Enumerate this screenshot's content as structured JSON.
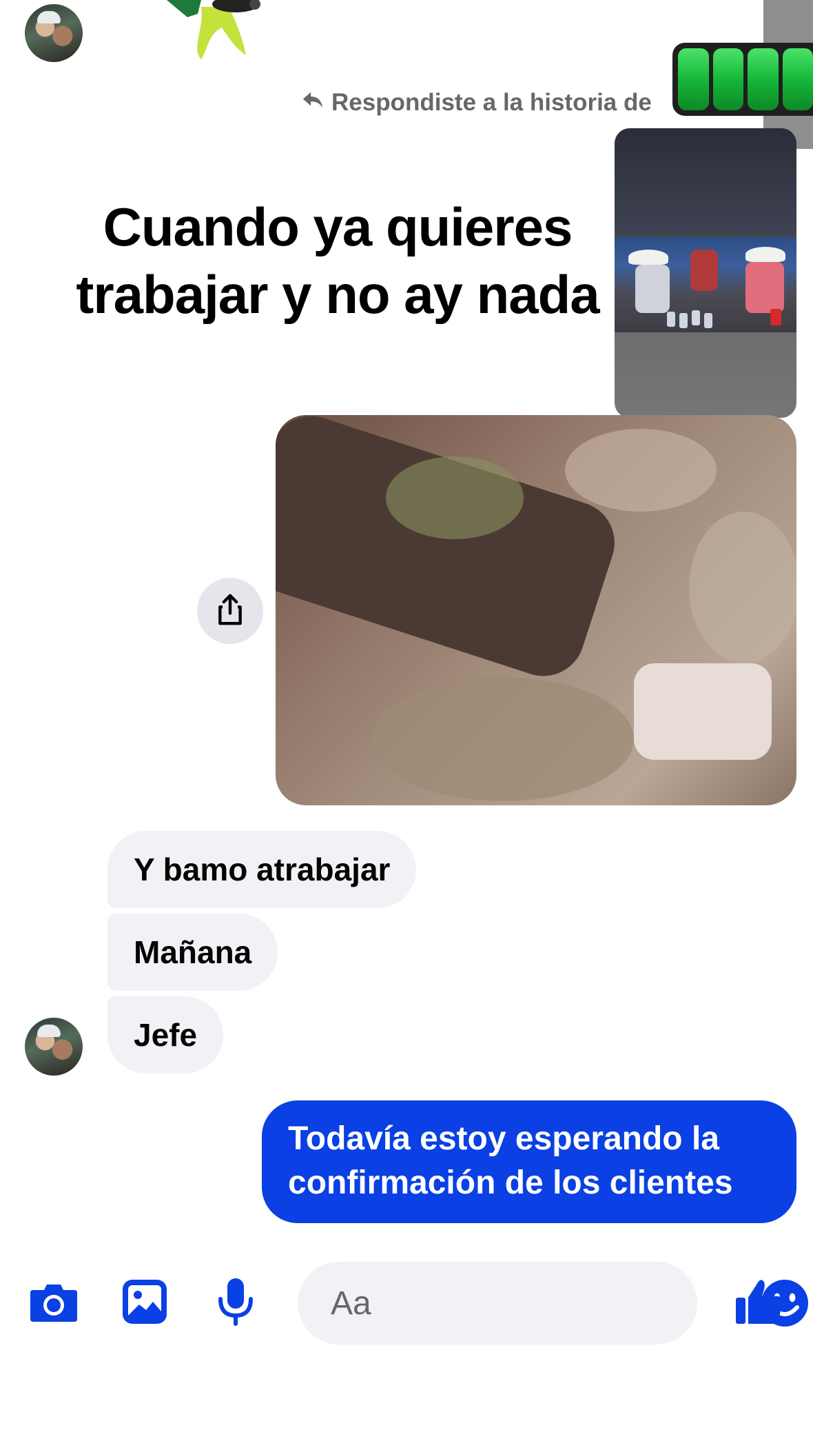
{
  "story_reply": {
    "label": "Respondiste a la historia de"
  },
  "meme": {
    "caption_line1": "Cuando ya quieres",
    "caption_line2": "trabajar y no ay nada"
  },
  "messages_in": [
    {
      "text": "Y bamo atrabajar"
    },
    {
      "text": "Mañana"
    },
    {
      "text": "Jefe"
    }
  ],
  "messages_out": [
    {
      "line1": "Todavía estoy esperando la",
      "line2": "confirmación de los clientes"
    }
  ],
  "composer": {
    "placeholder": "Aa"
  },
  "icons": {
    "camera": "camera-icon",
    "gallery": "gallery-icon",
    "mic": "microphone-icon",
    "emoji": "emoji-icon",
    "like": "thumbs-up-icon",
    "share": "share-icon",
    "reply": "reply-arrow-icon"
  },
  "colors": {
    "accent": "#0a40e4",
    "incoming_bubble": "#f0f2f5",
    "secondary_text": "#65676b"
  }
}
